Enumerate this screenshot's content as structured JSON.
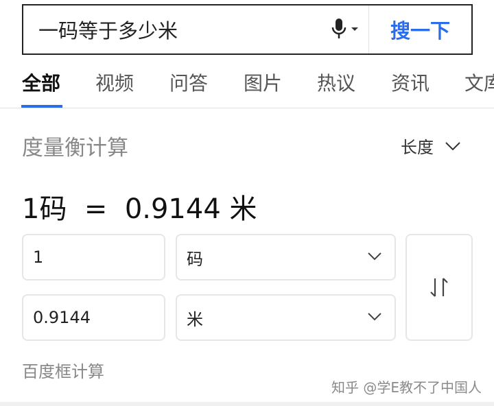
{
  "search": {
    "query": "一码等于多少米",
    "button_label": "搜一下"
  },
  "tabs": [
    {
      "label": "全部",
      "active": true
    },
    {
      "label": "视频",
      "active": false
    },
    {
      "label": "问答",
      "active": false
    },
    {
      "label": "图片",
      "active": false
    },
    {
      "label": "热议",
      "active": false
    },
    {
      "label": "资讯",
      "active": false
    },
    {
      "label": "文库",
      "active": false
    }
  ],
  "calculator": {
    "title": "度量衡计算",
    "mode": "长度",
    "result_text": "1码  =  0.9144 米",
    "from_value": "1",
    "from_unit": "码",
    "to_value": "0.9144",
    "to_unit": "米",
    "footer": "百度框计算"
  },
  "watermark": "知乎 @学E教不了中国人",
  "colors": {
    "accent": "#2b6de8",
    "muted_text": "#888888",
    "border": "#e6e6e6"
  },
  "icons": {
    "mic": "microphone-icon",
    "dropdown": "chevron-down-icon",
    "swap": "swap-arrows-icon"
  }
}
